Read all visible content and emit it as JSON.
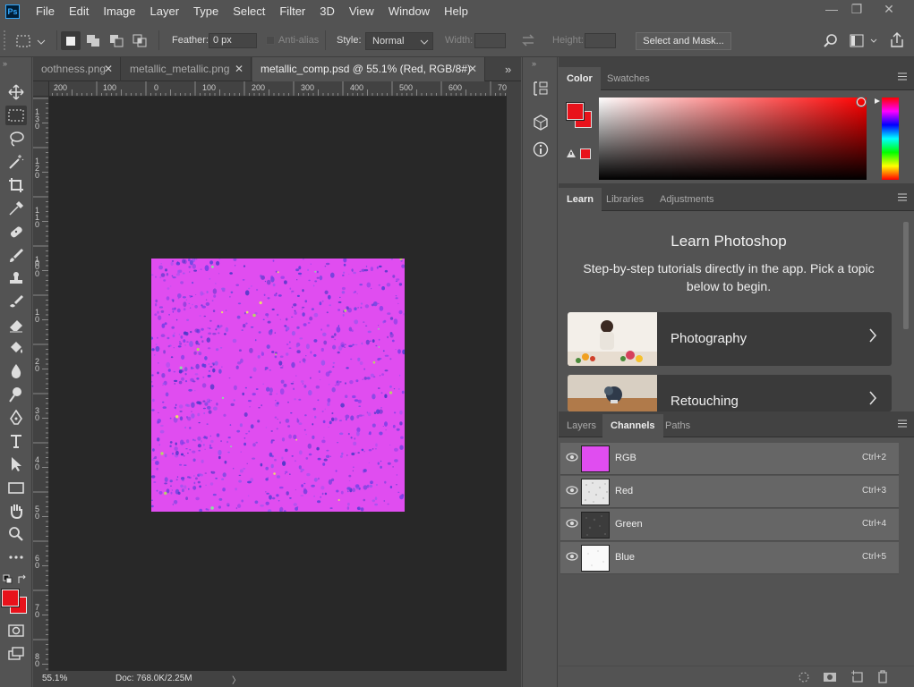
{
  "app": {
    "logo_text": "Ps"
  },
  "menu": [
    "File",
    "Edit",
    "Image",
    "Layer",
    "Type",
    "Select",
    "Filter",
    "3D",
    "View",
    "Window",
    "Help"
  ],
  "window_controls": {
    "minimize": "—",
    "restore": "❐",
    "close": "✕"
  },
  "options_bar": {
    "feather_label": "Feather:",
    "feather_value": "0 px",
    "antialias_label": "Anti-alias",
    "style_label": "Style:",
    "style_value": "Normal",
    "width_label": "Width:",
    "height_label": "Height:",
    "select_mask_label": "Select and Mask..."
  },
  "document_tabs": [
    {
      "label": "oothness.png",
      "close": "✕"
    },
    {
      "label": "metallic_metallic.png",
      "close": "✕"
    },
    {
      "label": "metallic_comp.psd @ 55.1% (Red, RGB/8#)",
      "close": "✕"
    }
  ],
  "ruler_top": [
    "200",
    "100",
    "0",
    "100",
    "200",
    "300",
    "400",
    "500",
    "600",
    "70"
  ],
  "ruler_left": [
    "1\n3\n0",
    "1\n2\n0",
    "1\n1\n0",
    "1\n0\n0",
    "0",
    "1\n0",
    "2\n0",
    "3\n0",
    "4\n0",
    "5\n0",
    "6\n0",
    "7\n0",
    "8\n0"
  ],
  "status": {
    "zoom": "55.1%",
    "doc": "Doc: 768.0K/2.25M",
    "arrow": "〉"
  },
  "color_panel": {
    "tabs": [
      "Color",
      "Swatches"
    ],
    "foreground": "#e8121b",
    "background": "#e8121b",
    "hue": "#ff0000"
  },
  "learn_panel": {
    "tabs": [
      "Learn",
      "Libraries",
      "Adjustments"
    ],
    "title": "Learn Photoshop",
    "subtitle": "Step-by-step tutorials directly in the app. Pick a topic below to begin.",
    "cards": [
      {
        "label": "Photography"
      },
      {
        "label": "Retouching"
      }
    ]
  },
  "channels_panel": {
    "tabs": [
      "Layers",
      "Channels",
      "Paths"
    ],
    "channels": [
      {
        "name": "RGB",
        "shortcut": "Ctrl+2"
      },
      {
        "name": "Red",
        "shortcut": "Ctrl+3"
      },
      {
        "name": "Green",
        "shortcut": "Ctrl+4"
      },
      {
        "name": "Blue",
        "shortcut": "Ctrl+5"
      }
    ]
  },
  "colors": {
    "accent_blue": "#31a8ff",
    "document_magenta": "#e04df0",
    "speckle_blue": "#5a3fd8"
  }
}
